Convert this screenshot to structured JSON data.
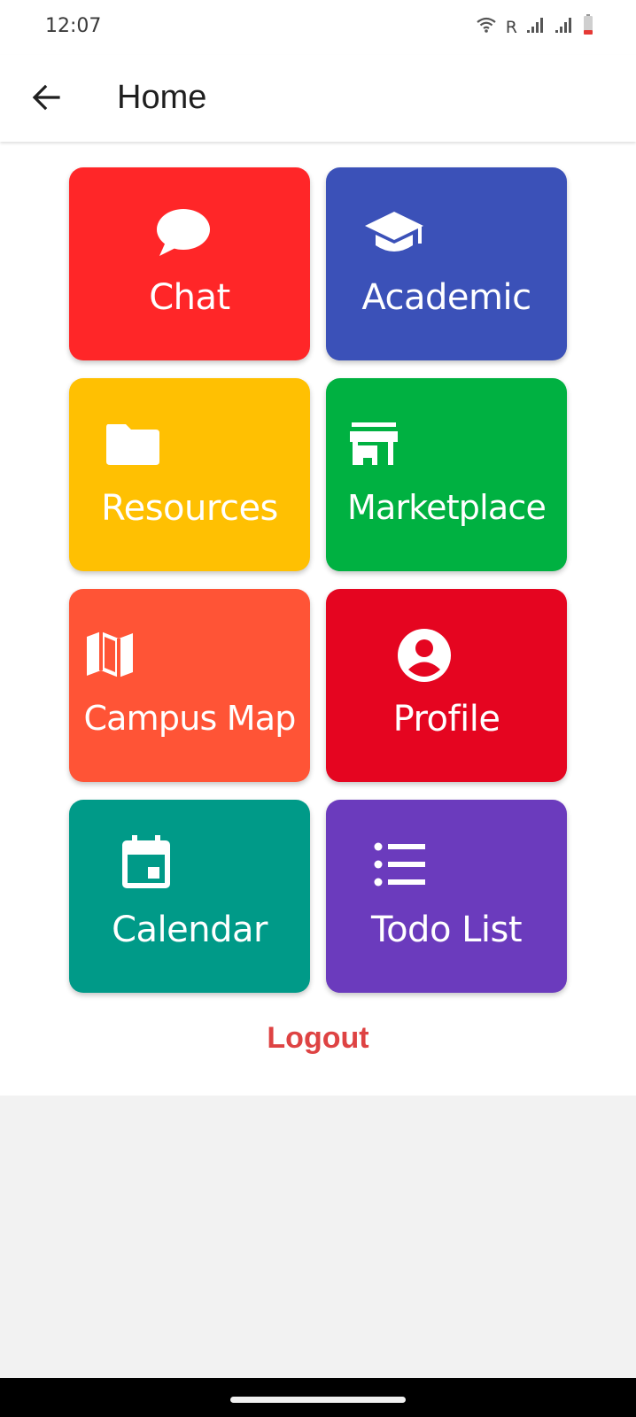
{
  "status_bar": {
    "time": "12:07",
    "roaming": "R",
    "icons": [
      "wifi-icon",
      "signal-icon",
      "signal-icon",
      "battery-low-icon"
    ]
  },
  "app_bar": {
    "title": "Home",
    "back_icon": "arrow-left-icon"
  },
  "tiles": [
    {
      "label": "Chat",
      "icon": "chat-bubble-icon",
      "color": "#ff2628"
    },
    {
      "label": "Academic",
      "icon": "graduation-cap-icon",
      "color": "#3b51b8"
    },
    {
      "label": "Resources",
      "icon": "folder-icon",
      "color": "#ffc002"
    },
    {
      "label": "Marketplace",
      "icon": "storefront-icon",
      "color": "#00b141"
    },
    {
      "label": "Campus Map",
      "icon": "map-icon",
      "color": "#ff5436"
    },
    {
      "label": "Profile",
      "icon": "account-circle-icon",
      "color": "#e50520"
    },
    {
      "label": "Calendar",
      "icon": "calendar-icon",
      "color": "#009a88"
    },
    {
      "label": "Todo List",
      "icon": "list-icon",
      "color": "#6b3bbd"
    }
  ],
  "logout": {
    "label": "Logout",
    "color": "#de4343"
  }
}
